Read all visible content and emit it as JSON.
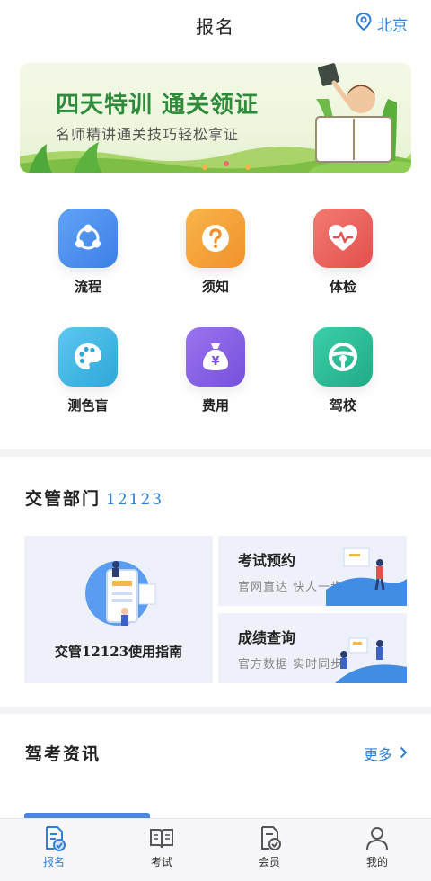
{
  "header": {
    "title": "报名",
    "location": "北京",
    "location_icon": "location-pin-icon"
  },
  "banner": {
    "title": "四天特训 通关领证",
    "subtitle": "名师精讲通关技巧轻松拿证"
  },
  "services": [
    {
      "label": "流程",
      "icon": "flow-icon",
      "color": "#4d8ff0"
    },
    {
      "label": "须知",
      "icon": "question-icon",
      "color": "#f5a23a"
    },
    {
      "label": "体检",
      "icon": "heart-pulse-icon",
      "color": "#ef6060"
    },
    {
      "label": "测色盲",
      "icon": "palette-icon",
      "color": "#3fb6e3"
    },
    {
      "label": "费用",
      "icon": "money-bag-icon",
      "color": "#8a63e6"
    },
    {
      "label": "驾校",
      "icon": "steering-wheel-icon",
      "color": "#2fbf9a"
    }
  ],
  "traffic": {
    "title": "交管部门",
    "number": "12123",
    "guide_label": "交管12123使用指南",
    "cards": [
      {
        "title": "考试预约",
        "subtitle": "官网直达 快人一步"
      },
      {
        "title": "成绩查询",
        "subtitle": "官方数据 实时同步"
      }
    ]
  },
  "news": {
    "title": "驾考资讯",
    "more_label": "更多"
  },
  "tabbar": [
    {
      "label": "报名",
      "icon": "signup-icon",
      "active": true
    },
    {
      "label": "考试",
      "icon": "book-icon",
      "active": false
    },
    {
      "label": "会员",
      "icon": "member-icon",
      "active": false
    },
    {
      "label": "我的",
      "icon": "user-icon",
      "active": false
    }
  ],
  "colors": {
    "accent": "#2f7fd8",
    "banner_green": "#2e8b3a",
    "card_bg": "#eef1f9"
  }
}
